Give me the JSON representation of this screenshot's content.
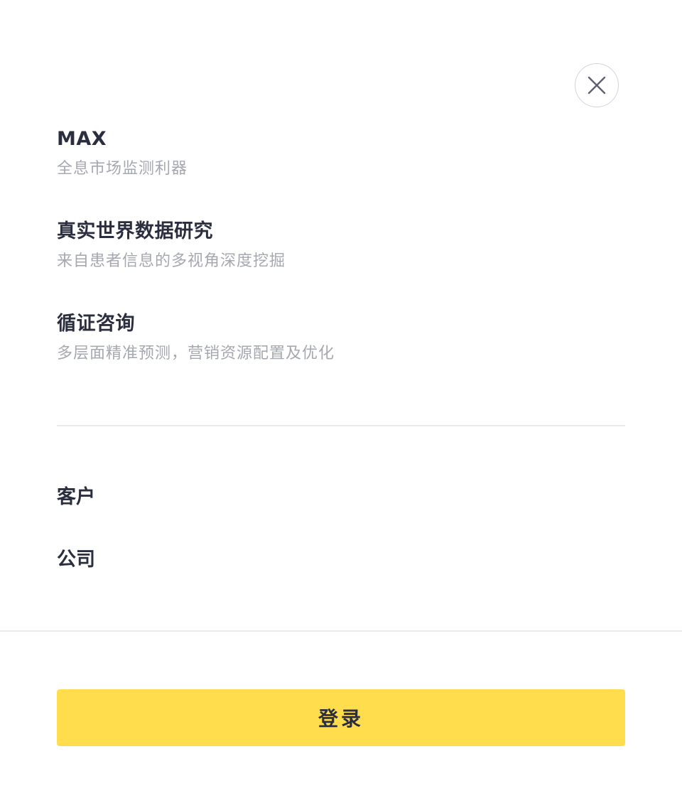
{
  "close": {
    "icon": "close-icon"
  },
  "products": [
    {
      "title": "MAX",
      "description": "全息市场监测利器"
    },
    {
      "title": "真实世界数据研究",
      "description": "来自患者信息的多视角深度挖掘"
    },
    {
      "title": "循证咨询",
      "description": "多层面精准预测，营销资源配置及优化"
    }
  ],
  "nav": {
    "customer_label": "客户",
    "company_label": "公司"
  },
  "login": {
    "label": "登录"
  },
  "colors": {
    "accent": "#ffdd4d",
    "text": "#2b2e3e",
    "muted": "#a6a8b0",
    "divider": "#e9eaed"
  }
}
